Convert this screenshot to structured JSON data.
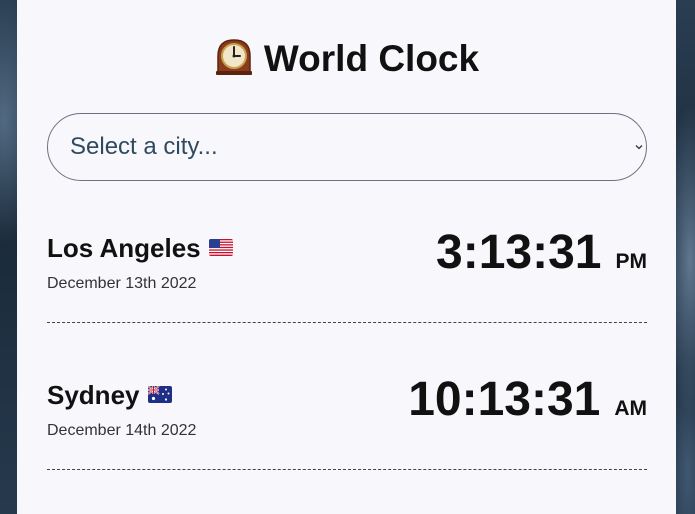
{
  "header": {
    "title": "World Clock",
    "icon": "mantelpiece-clock-icon"
  },
  "city_select": {
    "placeholder": "Select a city..."
  },
  "cities": [
    {
      "name": "Los Angeles",
      "flag": "us-flag-icon",
      "date": "December 13th 2022",
      "time": "3:13:31",
      "ampm": "PM"
    },
    {
      "name": "Sydney",
      "flag": "australia-flag-icon",
      "date": "December 14th 2022",
      "time": "10:13:31",
      "ampm": "AM"
    }
  ],
  "colors": {
    "card_background": "#f8f8fc",
    "select_text": "#2f4a5e",
    "text": "#111111"
  }
}
